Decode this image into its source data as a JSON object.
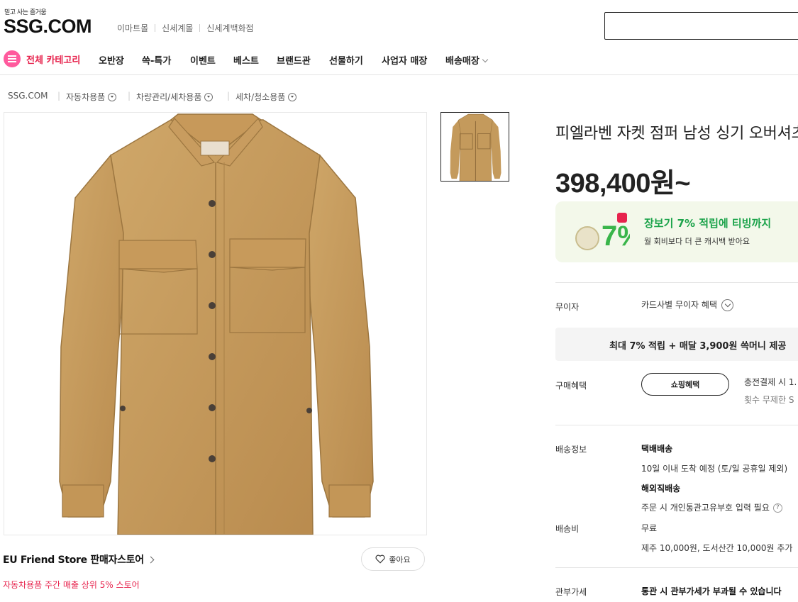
{
  "header": {
    "tagline": "믿고 사는 즐거움",
    "logo": "SSG.COM",
    "affiliates": [
      "이마트몰",
      "신세계몰",
      "신세계백화점"
    ]
  },
  "nav": {
    "all_categories": "전체 카테고리",
    "items": [
      "오반장",
      "쓱-특가",
      "이벤트",
      "베스트",
      "브랜드관",
      "선물하기",
      "사업자 매장",
      "배송매장"
    ]
  },
  "breadcrumb": [
    "SSG.COM",
    "자동차용품",
    "차량관리/세차용품",
    "세차/청소용품"
  ],
  "product": {
    "title": "피엘라벤 자켓 점퍼 남성 싱기 오버셔츠",
    "price": "398,400원~",
    "promo_title": "장보기 7% 적립에 티빙까지",
    "promo_sub": "월 회비보다 더 큰 캐시백 받아요",
    "promo_badge": "7%"
  },
  "seller": {
    "name": "EU Friend Store 판매자스토어",
    "sub": "자동차용품 주간 매출 상위 5% 스토어",
    "like_label": "좋아요"
  },
  "details": {
    "interest_label": "무이자",
    "interest_value": "카드사별 무이자 혜택",
    "benefit_bar": "최대 7% 적립 + 매달 3,900원 쓱머니 제공",
    "purchase_label": "구매혜택",
    "shop_button": "쇼핑혜택",
    "purchase_line1": "충전결제 시 1.",
    "purchase_line2": "횟수 무제한 S",
    "shipping_label": "배송정보",
    "shipping_type1": "택배배송",
    "shipping_desc1": "10일 이내 도착 예정 (토/일 공휴일 제외)",
    "shipping_type2": "해외직배송",
    "shipping_desc2": "주문 시 개인통관고유부호 입력 필요",
    "fee_label": "배송비",
    "fee_value": "무료",
    "fee_extra": "제주 10,000원, 도서산간 10,000원 추가",
    "customs_label": "관부가세",
    "customs_value": "통관 시 관부가세가 부과될 수 있습니다"
  },
  "colors": {
    "accent_pink": "#e7234d",
    "promo_green": "#1ba34a",
    "jacket": "#c49a5c"
  }
}
